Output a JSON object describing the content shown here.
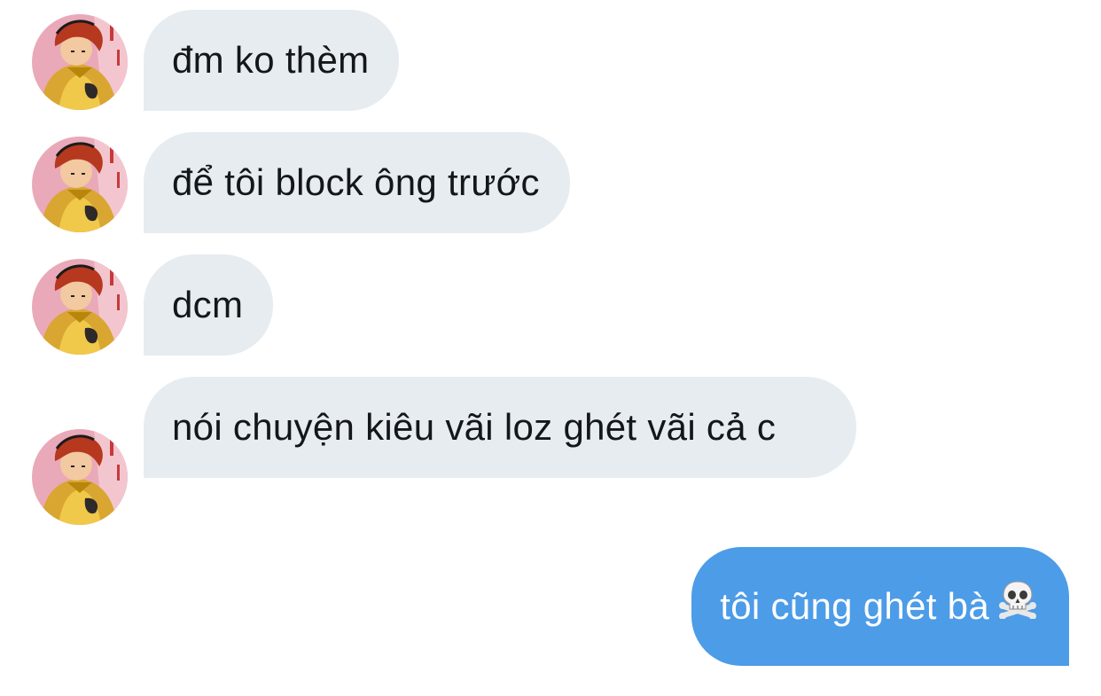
{
  "conversation": {
    "messages": [
      {
        "direction": "received",
        "text": "đm ko thèm"
      },
      {
        "direction": "received",
        "text": "để tôi block ông trước"
      },
      {
        "direction": "received",
        "text": "dcm"
      },
      {
        "direction": "received",
        "text": "nói chuyện kiêu vãi loz ghét vãi cả c"
      },
      {
        "direction": "sent",
        "text": "tôi cũng ghét bà",
        "trailing_emoji": "skull-and-crossbones-icon"
      }
    ]
  },
  "colors": {
    "received_bubble": "#e6ecf0",
    "sent_bubble": "#4c9ce8",
    "received_text": "#14171a",
    "sent_text": "#ffffff"
  }
}
